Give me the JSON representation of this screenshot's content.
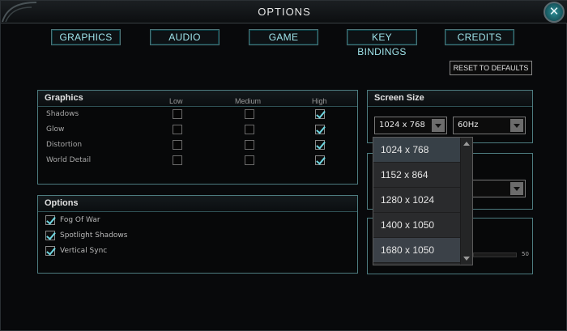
{
  "window": {
    "title": "OPTIONS",
    "close_glyph": "✕",
    "accent_color": "#6fd6e1"
  },
  "tabs": [
    "GRAPHICS",
    "AUDIO",
    "GAME",
    "KEY BINDINGS",
    "CREDITS"
  ],
  "reset_label": "RESET TO DEFAULTS",
  "graphics": {
    "header": "Graphics",
    "columns": [
      "Low",
      "Medium",
      "High"
    ],
    "rows": [
      {
        "label": "Shadows",
        "level": "High"
      },
      {
        "label": "Glow",
        "level": "High"
      },
      {
        "label": "Distortion",
        "level": "High"
      },
      {
        "label": "World Detail",
        "level": "High"
      }
    ]
  },
  "options": {
    "header": "Options",
    "items": [
      {
        "label": "Fog Of War",
        "checked": true
      },
      {
        "label": "Spotlight Shadows",
        "checked": true
      },
      {
        "label": "Vertical Sync",
        "checked": true
      }
    ]
  },
  "screen_size": {
    "header": "Screen Size",
    "resolution": "1024 x 768",
    "refresh": "60Hz",
    "dropdown_options": [
      "1024 x  768",
      "1152 x  864",
      "1280 x 1024",
      "1400 x 1050",
      "1680 x 1050"
    ]
  },
  "hidden_slider_value": "50"
}
